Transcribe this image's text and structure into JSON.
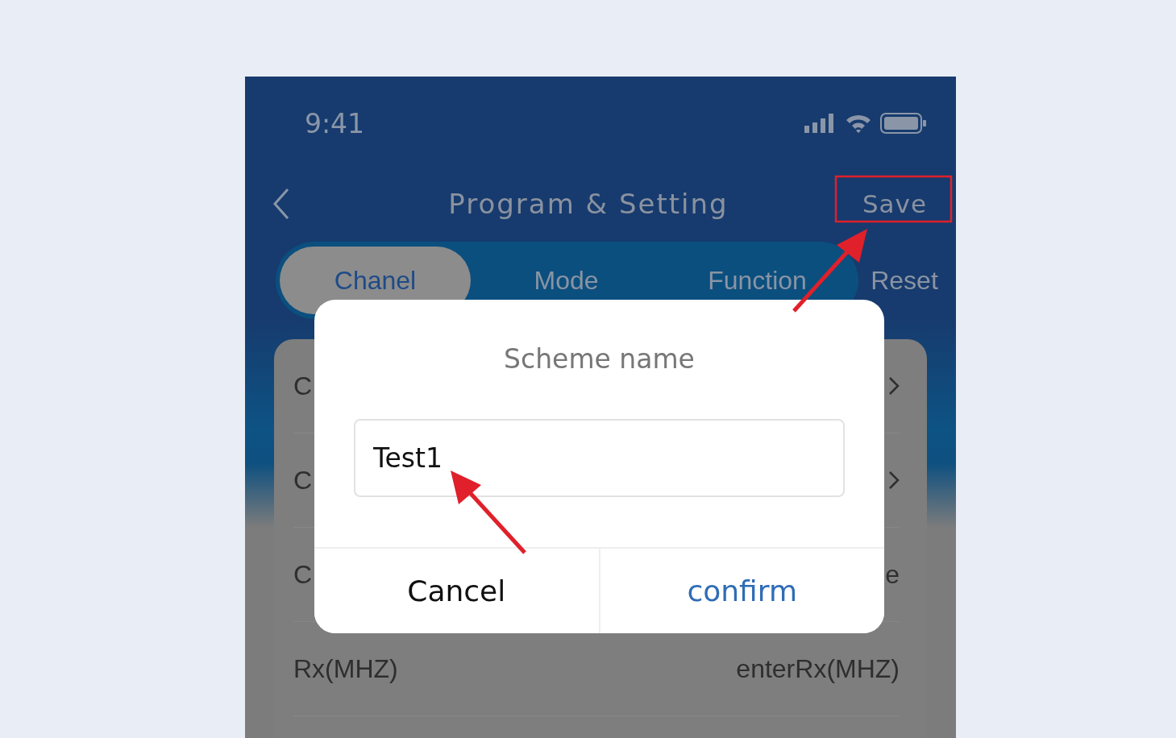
{
  "status_bar": {
    "time": "9:41"
  },
  "header": {
    "title": "Program & Setting",
    "action": "Save"
  },
  "tabs": [
    {
      "label": "Chanel",
      "selected": true
    },
    {
      "label": "Mode",
      "selected": false
    },
    {
      "label": "Function",
      "selected": false
    },
    {
      "label": "Reset",
      "selected": false
    }
  ],
  "rows": [
    {
      "label": "C",
      "kind": "link"
    },
    {
      "label": "C",
      "kind": "link"
    },
    {
      "label": "C",
      "kind": "value",
      "value": "e"
    },
    {
      "label": "Rx(MHZ)",
      "kind": "value",
      "value": "enterRx(MHZ)"
    }
  ],
  "dialog": {
    "title": "Scheme name",
    "field_value": "Test1",
    "buttons": [
      {
        "label": "Cancel",
        "kind": "cancel"
      },
      {
        "label": "confirm",
        "kind": "confirm"
      }
    ]
  }
}
